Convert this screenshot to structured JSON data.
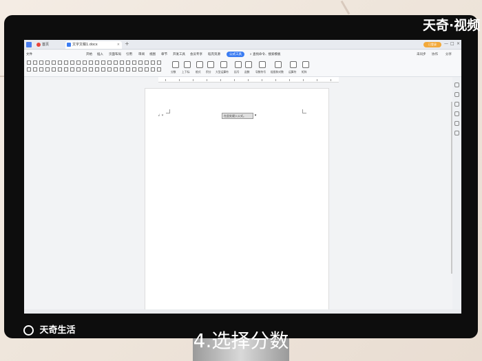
{
  "watermark": {
    "top_text": "天奇·视频",
    "bottom_text": "天奇生活"
  },
  "caption": "4.选择分数",
  "tabs": {
    "home_label": "首页",
    "doc_label": "文字文稿1.docx",
    "close_glyph": "×",
    "new_tab_glyph": "+"
  },
  "titlebar": {
    "user_label": "已登录",
    "minimize": "—",
    "maximize": "□",
    "close": "×"
  },
  "menu": {
    "file": "文件",
    "items": [
      "开始",
      "插入",
      "页面布局",
      "引用",
      "审阅",
      "视图",
      "章节",
      "开发工具",
      "会员专享",
      "稻壳资源",
      "公式工具"
    ],
    "search": "查找命令、搜索模板",
    "right_items": [
      "未同步",
      "协作",
      "分享"
    ]
  },
  "ribbon": {
    "groups": [
      "分数",
      "上下标",
      "根式",
      "积分",
      "大型运算符",
      "括号",
      "函数",
      "导数符号",
      "极限和对数",
      "运算符",
      "矩阵"
    ]
  },
  "document": {
    "field_text": "在此处键入公式。",
    "field_arrow": "▾",
    "para_mark": "↲ ▾"
  },
  "colors": {
    "accent": "#3b7cf2",
    "user": "#f2a93b"
  }
}
